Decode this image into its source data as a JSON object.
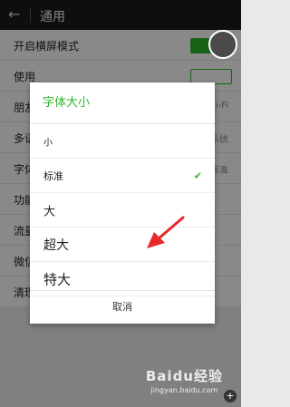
{
  "header": {
    "back_icon": "back-arrow-icon",
    "title": "通用"
  },
  "settings": [
    {
      "label": "开启横屏模式",
      "value": "",
      "control": "toggle-on"
    },
    {
      "label": "使用",
      "value": "",
      "control": "toggle-outline"
    },
    {
      "label": "朋友",
      "value": "i-Fi",
      "control": "value"
    },
    {
      "label": "多语",
      "value": "系统",
      "control": "value"
    },
    {
      "label": "字体",
      "value": "标准",
      "control": "value"
    },
    {
      "label": "功能",
      "value": "",
      "control": "none"
    },
    {
      "label": "流量",
      "value": "",
      "control": "none"
    },
    {
      "label": "微信",
      "value": "",
      "control": "none"
    },
    {
      "label": "清理",
      "value": "",
      "control": "none"
    }
  ],
  "dialog": {
    "title": "字体大小",
    "options": [
      "小",
      "标准",
      "大",
      "超大",
      "特大"
    ],
    "selected": "标准",
    "cancel": "取消"
  },
  "colors": {
    "accent": "#2fb52c",
    "annotation_arrow": "#e8282b"
  },
  "watermark": {
    "brand": "Baidu经验",
    "url": "jingyan.baidu.com"
  }
}
